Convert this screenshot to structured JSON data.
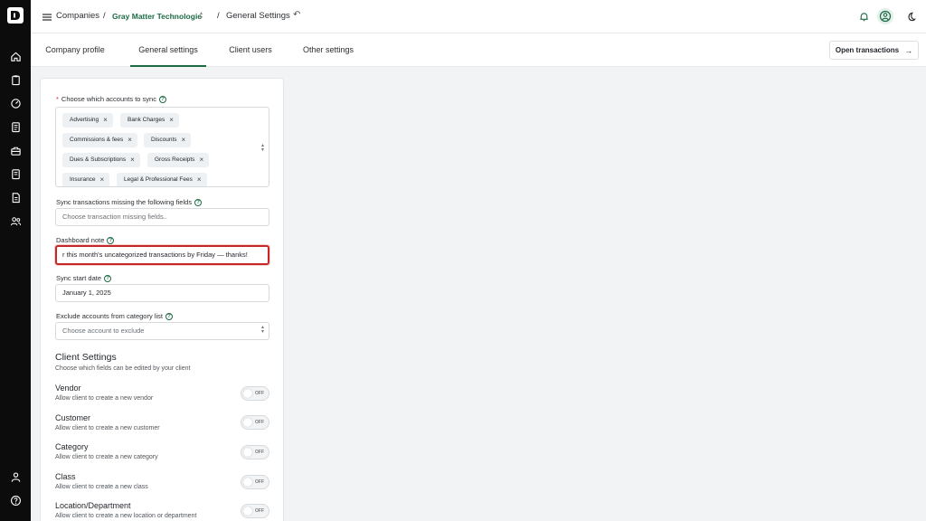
{
  "header": {
    "breadcrumb_root": "Companies",
    "separator": "/",
    "company": "Gray Matter Technologie",
    "page": "General Settings"
  },
  "tabs": [
    {
      "label": "Company profile",
      "active": false
    },
    {
      "label": "General settings",
      "active": true
    },
    {
      "label": "Client users",
      "active": false
    },
    {
      "label": "Other settings",
      "active": false
    }
  ],
  "open_transactions_label": "Open transactions",
  "form": {
    "accounts_label": "Choose which accounts to sync",
    "required_mark": "*",
    "accounts_chips": [
      "Advertising",
      "Bank Charges",
      "Commissions & fees",
      "Discounts",
      "Dues & Subscriptions",
      "Gross Receipts",
      "Insurance",
      "Legal & Professional Fees"
    ],
    "missing_fields_label": "Sync transactions missing the following fields",
    "missing_fields_placeholder": "Choose transaction missing fields..",
    "dashboard_note_label": "Dashboard note",
    "dashboard_note_value": "r this month's uncategorized transactions by Friday — thanks!",
    "sync_start_label": "Sync start date",
    "sync_start_value": "January 1, 2025",
    "exclude_label": "Exclude accounts from category list",
    "exclude_placeholder": "Choose account to exclude"
  },
  "client_settings": {
    "title": "Client Settings",
    "subtitle": "Choose which fields can be edited by your client",
    "items": [
      {
        "title": "Vendor",
        "desc": "Allow client to create a new vendor",
        "state": "OFF"
      },
      {
        "title": "Customer",
        "desc": "Allow client to create a new customer",
        "state": "OFF"
      },
      {
        "title": "Category",
        "desc": "Allow client to create a new category",
        "state": "OFF"
      },
      {
        "title": "Class",
        "desc": "Allow client to create a new class",
        "state": "OFF"
      },
      {
        "title": "Location/Department",
        "desc": "Allow client to create a new location or department",
        "state": "OFF"
      }
    ]
  },
  "icons": {
    "sidebar": [
      "logo-icon",
      "home-icon",
      "clipboard-icon",
      "gauge-icon",
      "document-icon",
      "briefcase-icon",
      "ledger-icon",
      "report-icon",
      "users-icon",
      "user-icon",
      "help-icon"
    ],
    "header": [
      "menu-icon",
      "bell-icon",
      "account-circle-icon",
      "moon-icon"
    ]
  },
  "colors": {
    "brand_green": "#1d6b45",
    "focus_red": "#c62828",
    "sidebar_bg": "#0c0c0c"
  }
}
